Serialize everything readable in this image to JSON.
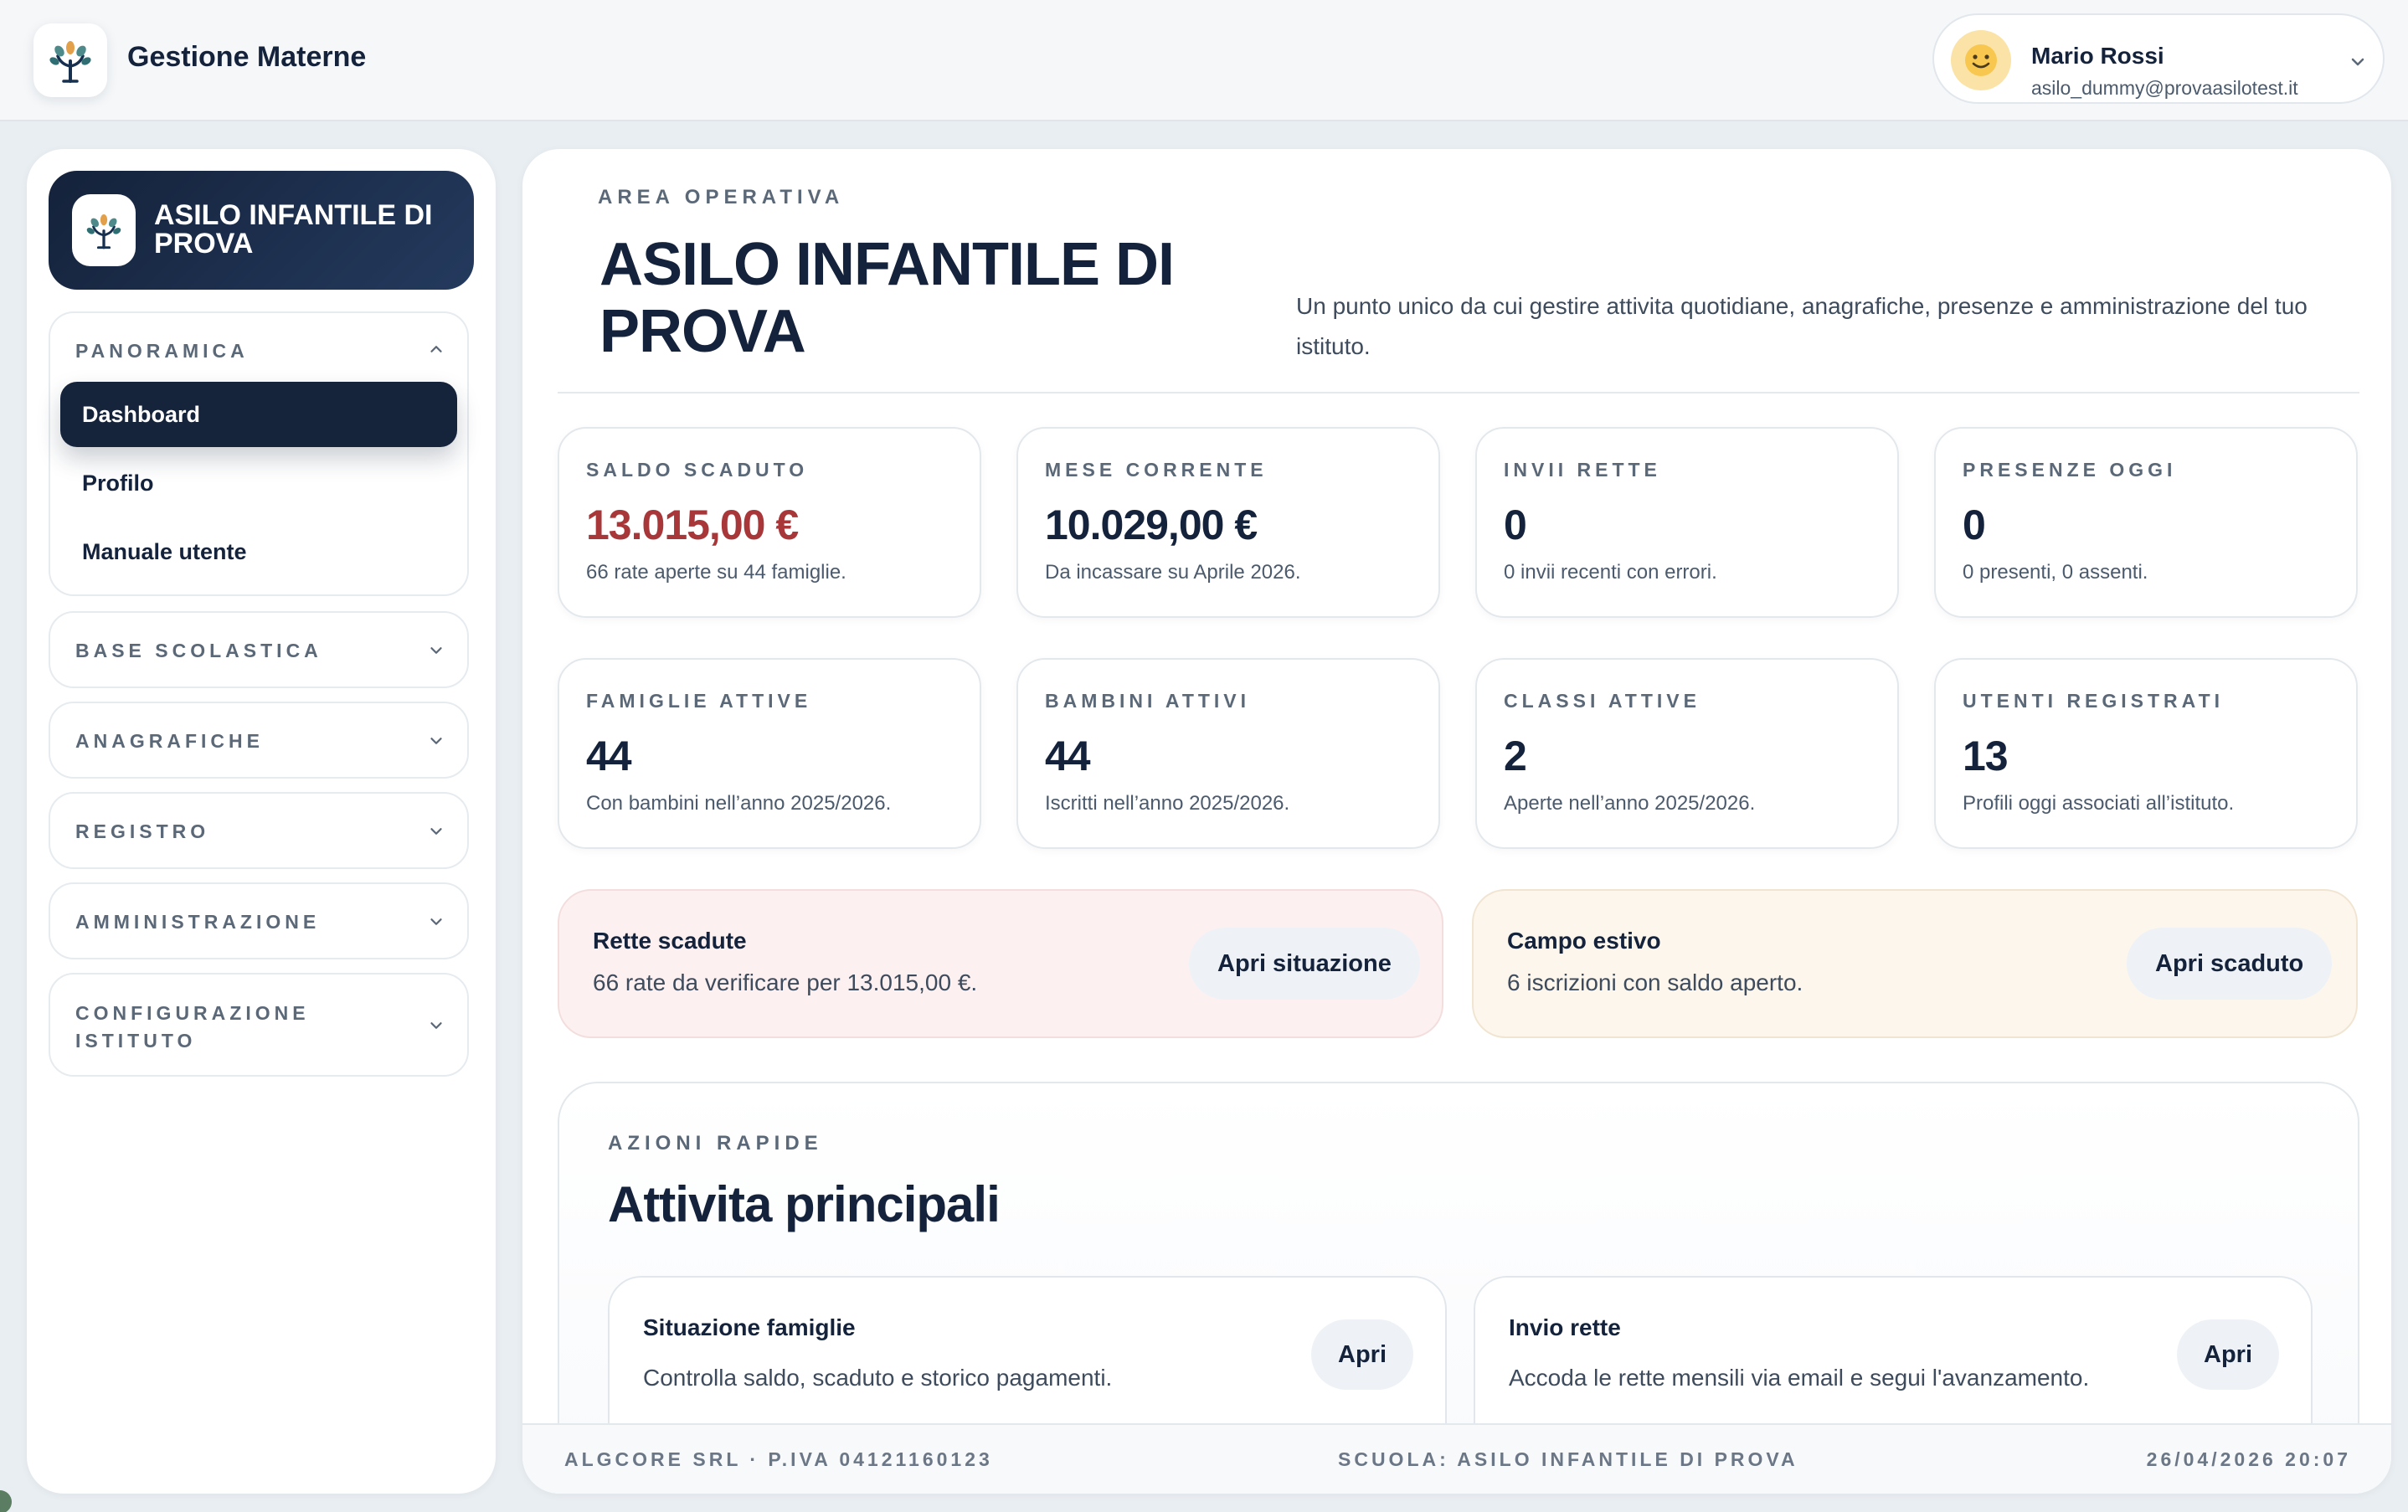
{
  "app": {
    "name": "Gestione Materne",
    "logo_icon": "tree-icon"
  },
  "user": {
    "name": "Mario Rossi",
    "email": "asilo_dummy@provaasilotest.it",
    "avatar_icon": "smiley-avatar-icon"
  },
  "sidebar": {
    "school_name": "ASILO INFANTILE DI PROVA",
    "groups": [
      {
        "label": "PANORAMICA",
        "expanded": true,
        "items": [
          {
            "label": "Dashboard",
            "active": true
          },
          {
            "label": "Profilo",
            "active": false
          },
          {
            "label": "Manuale utente",
            "active": false
          }
        ]
      },
      {
        "label": "BASE SCOLASTICA",
        "expanded": false
      },
      {
        "label": "ANAGRAFICHE",
        "expanded": false
      },
      {
        "label": "REGISTRO",
        "expanded": false
      },
      {
        "label": "AMMINISTRAZIONE",
        "expanded": false
      },
      {
        "label": "CONFIGURAZIONE ISTITUTO",
        "expanded": false
      }
    ]
  },
  "hero": {
    "eyebrow": "AREA OPERATIVA",
    "title": "ASILO INFANTILE DI PROVA",
    "description": "Un punto unico da cui gestire attivita quotidiane, anagrafiche, presenze e amministrazione del tuo istituto."
  },
  "stats": [
    {
      "label": "SALDO SCADUTO",
      "value": "13.015,00 €",
      "sub": "66 rate aperte su 44 famiglie.",
      "alert": true
    },
    {
      "label": "MESE CORRENTE",
      "value": "10.029,00 €",
      "sub": "Da incassare su Aprile 2026."
    },
    {
      "label": "INVII RETTE",
      "value": "0",
      "sub": "0 invii recenti con errori."
    },
    {
      "label": "PRESENZE OGGI",
      "value": "0",
      "sub": "0 presenti, 0 assenti."
    },
    {
      "label": "FAMIGLIE ATTIVE",
      "value": "44",
      "sub": "Con bambini nell’anno 2025/2026."
    },
    {
      "label": "BAMBINI ATTIVI",
      "value": "44",
      "sub": "Iscritti nell’anno 2025/2026."
    },
    {
      "label": "CLASSI ATTIVE",
      "value": "2",
      "sub": "Aperte nell’anno 2025/2026."
    },
    {
      "label": "UTENTI REGISTRATI",
      "value": "13",
      "sub": "Profili oggi associati all’istituto."
    }
  ],
  "notices": [
    {
      "title": "Rette scadute",
      "sub": "66 rate da verificare per 13.015,00 €.",
      "button": "Apri situazione",
      "tone": "#fdf0f0"
    },
    {
      "title": "Campo estivo",
      "sub": "6 iscrizioni con saldo aperto.",
      "button": "Apri scaduto",
      "tone": "#fdf6ec"
    }
  ],
  "quick_actions": {
    "eyebrow": "AZIONI RAPIDE",
    "title": "Attivita principali",
    "cards": [
      {
        "title": "Situazione famiglie",
        "sub": "Controlla saldo, scaduto e storico pagamenti.",
        "button": "Apri"
      },
      {
        "title": "Invio rette",
        "sub": "Accoda le rette mensili via email e segui l'avanzamento.",
        "button": "Apri"
      }
    ]
  },
  "footer": {
    "company": "ALGCORE SRL · P.IVA 04121160123",
    "school": "SCUOLA: ASILO INFANTILE DI PROVA",
    "datetime": "26/04/2026 20:07"
  },
  "colors": {
    "navy": "#14233b",
    "alert_red": "#a8373a",
    "muted": "#5b6878"
  }
}
